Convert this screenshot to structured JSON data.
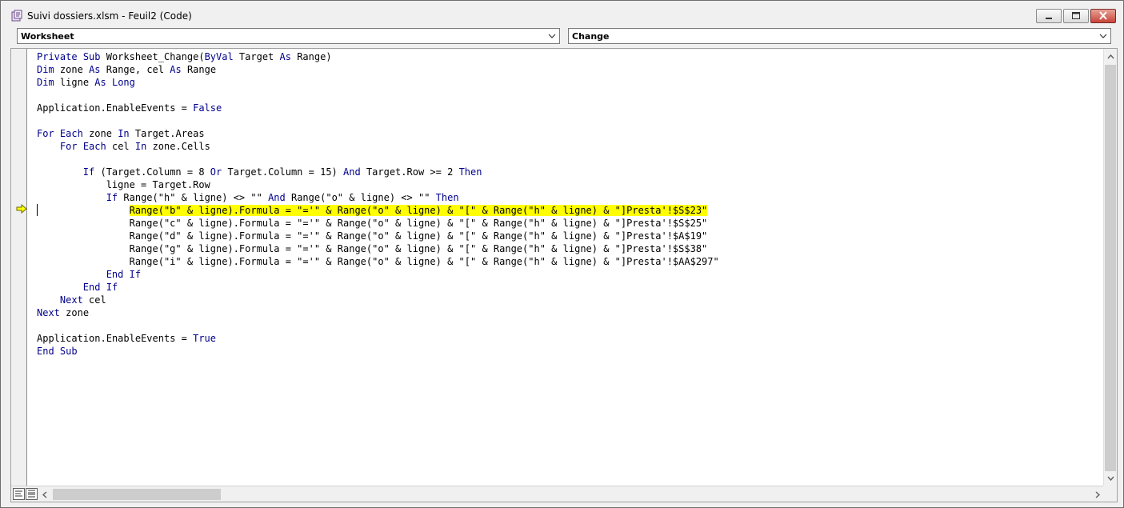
{
  "window": {
    "title": "Suivi dossiers.xlsm - Feuil2 (Code)",
    "icon": "vba-module-icon"
  },
  "object_combo": {
    "selected": "Worksheet"
  },
  "procedure_combo": {
    "selected": "Change"
  },
  "editor": {
    "highlight_color": "#ffff00",
    "keyword_color": "#00008b",
    "current_line_index": 12,
    "lines": [
      "Private Sub Worksheet_Change(ByVal Target As Range)",
      "Dim zone As Range, cel As Range",
      "Dim ligne As Long",
      "",
      "Application.EnableEvents = False",
      "",
      "For Each zone In Target.Areas",
      "    For Each cel In zone.Cells",
      "",
      "        If (Target.Column = 8 Or Target.Column = 15) And Target.Row >= 2 Then",
      "            ligne = Target.Row",
      "            If Range(\"h\" & ligne) <> \"\" And Range(\"o\" & ligne) <> \"\" Then",
      "                Range(\"b\" & ligne).Formula = \"='\" & Range(\"o\" & ligne) & \"[\" & Range(\"h\" & ligne) & \"]Presta'!$S$23\"",
      "                Range(\"c\" & ligne).Formula = \"='\" & Range(\"o\" & ligne) & \"[\" & Range(\"h\" & ligne) & \"]Presta'!$S$25\"",
      "                Range(\"d\" & ligne).Formula = \"='\" & Range(\"o\" & ligne) & \"[\" & Range(\"h\" & ligne) & \"]Presta'!$A$19\"",
      "                Range(\"g\" & ligne).Formula = \"='\" & Range(\"o\" & ligne) & \"[\" & Range(\"h\" & ligne) & \"]Presta'!$S$38\"",
      "                Range(\"i\" & ligne).Formula = \"='\" & Range(\"o\" & ligne) & \"[\" & Range(\"h\" & ligne) & \"]Presta'!$AA$297\"",
      "            End If",
      "        End If",
      "    Next cel",
      "Next zone",
      "",
      "Application.EnableEvents = True",
      "End Sub"
    ]
  }
}
